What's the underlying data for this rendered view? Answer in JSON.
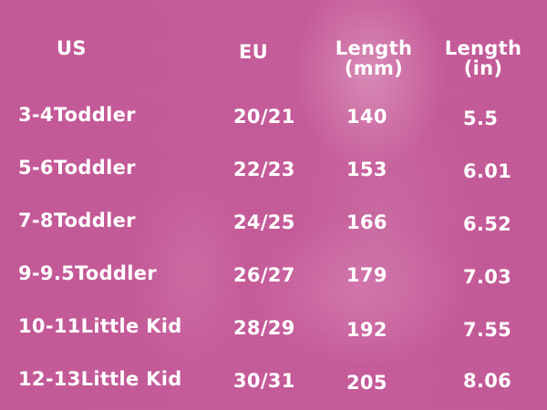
{
  "headers": {
    "us": "US",
    "eu": "EU",
    "length_mm_line1": "Length",
    "length_mm_line2": "(mm)",
    "length_in_line1": "Length",
    "length_in_line2": "(in)"
  },
  "rows": [
    {
      "us": "3-4Toddler",
      "eu": "20/21",
      "mm": "140",
      "in": "5.5"
    },
    {
      "us": "5-6Toddler",
      "eu": "22/23",
      "mm": "153",
      "in": "6.01"
    },
    {
      "us": "7-8Toddler",
      "eu": "24/25",
      "mm": "166",
      "in": "6.52"
    },
    {
      "us": "9-9.5Toddler",
      "eu": "26/27",
      "mm": "179",
      "in": "7.03"
    },
    {
      "us": "10-11Little Kid",
      "eu": "28/29",
      "mm": "192",
      "in": "7.55"
    },
    {
      "us": "12-13Little Kid",
      "eu": "30/31",
      "mm": "205",
      "in": "8.06"
    }
  ],
  "colors": {
    "background": "#c45a98",
    "text": "#ffffff"
  }
}
